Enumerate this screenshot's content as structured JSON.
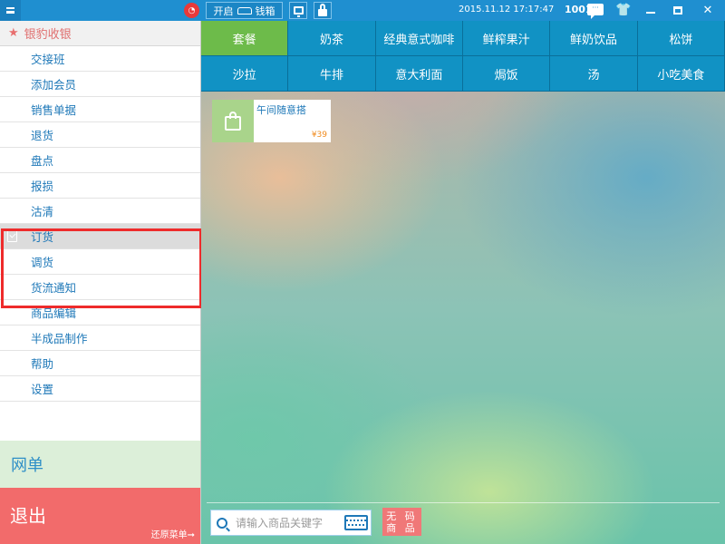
{
  "topbar": {
    "cashbox_open_label": "开启",
    "cashbox_label": "钱箱",
    "datetime": "2015.11.12  17:17:47",
    "user_id": "1001",
    "chat_glyph": "···",
    "shirt_glyph": "👕",
    "close_glyph": "✕",
    "wifi_glyph": "◔"
  },
  "sidebar": {
    "header": "银豹收银",
    "header_icon": "★",
    "items": [
      {
        "label": "交接班"
      },
      {
        "label": "添加会员"
      },
      {
        "label": "销售单据"
      },
      {
        "label": "退货"
      },
      {
        "label": "盘点"
      },
      {
        "label": "报损"
      },
      {
        "label": "沽清"
      },
      {
        "label": "订货"
      },
      {
        "label": "调货"
      },
      {
        "label": "货流通知"
      },
      {
        "label": "商品编辑"
      },
      {
        "label": "半成品制作"
      },
      {
        "label": "帮助"
      },
      {
        "label": "设置"
      }
    ],
    "active_index": 7,
    "web_order": "网单",
    "logout": "退出",
    "restore_menu": "还原菜单➞"
  },
  "categories": [
    {
      "label": "套餐"
    },
    {
      "label": "奶茶"
    },
    {
      "label": "经典意式咖啡"
    },
    {
      "label": "鲜榨果汁"
    },
    {
      "label": "鲜奶饮品"
    },
    {
      "label": "松饼"
    },
    {
      "label": "沙拉"
    },
    {
      "label": "牛排"
    },
    {
      "label": "意大利面"
    },
    {
      "label": "焗饭"
    },
    {
      "label": "汤"
    },
    {
      "label": "小吃美食"
    }
  ],
  "active_category": 0,
  "products": [
    {
      "name": "午间随意搭",
      "price": "¥39"
    }
  ],
  "search": {
    "placeholder": "请输入商品关键字"
  },
  "nocode_button": {
    "line1": "无 码",
    "line2": "商 品"
  },
  "colors": {
    "topbar": "#1f8fd0",
    "category_bg": "#1192c4",
    "category_active": "#6dbb4a",
    "logout_bg": "#f26b6b",
    "web_order_bg": "#dcefd9",
    "highlight_border": "#ee2b2b",
    "price": "#f08a1c"
  }
}
